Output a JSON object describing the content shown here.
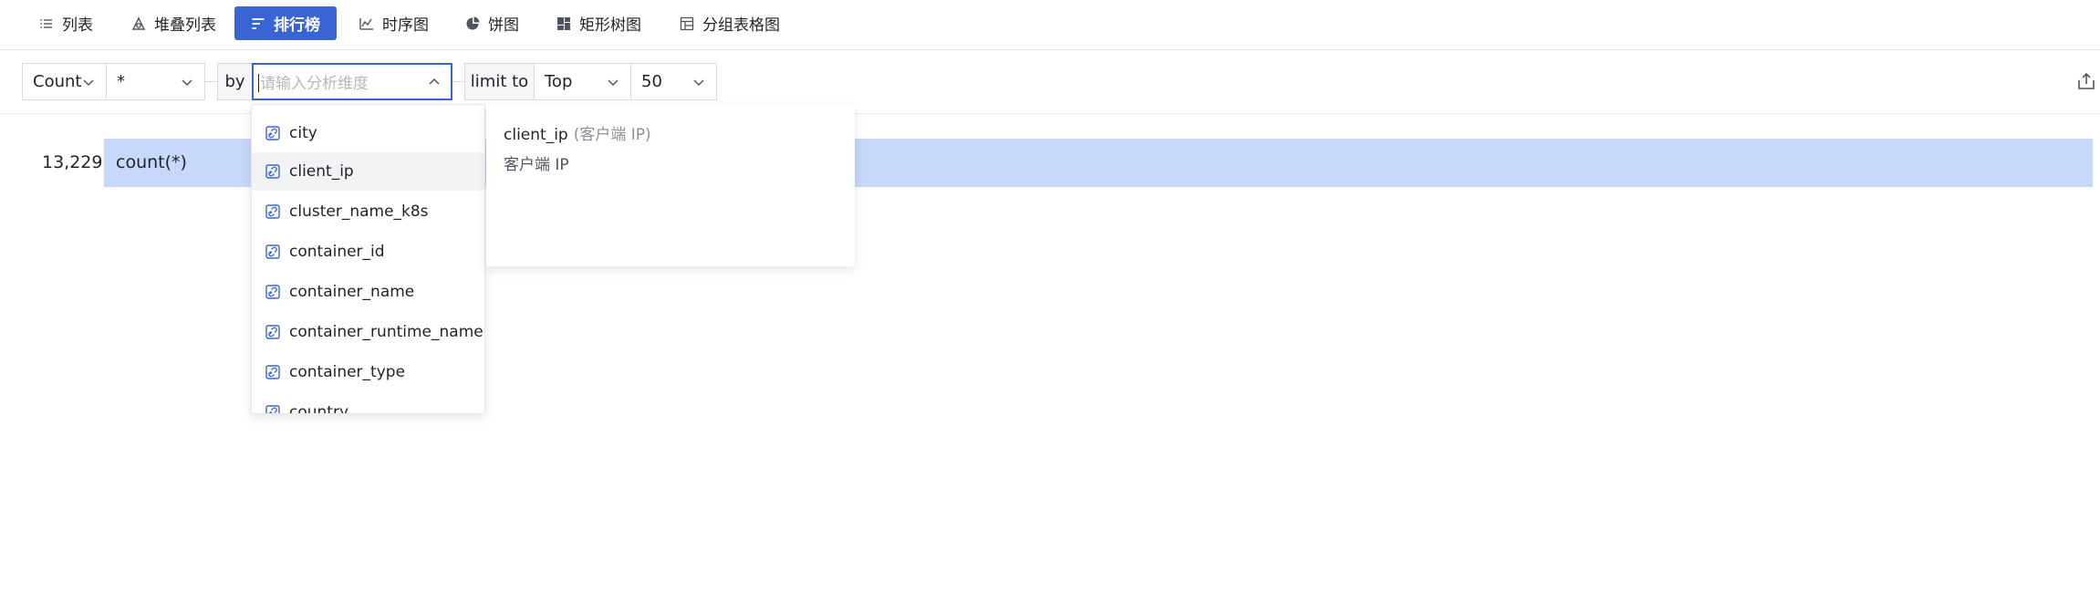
{
  "tabs": [
    {
      "label": "列表",
      "icon": "list-icon",
      "active": false
    },
    {
      "label": "堆叠列表",
      "icon": "stack-icon",
      "active": false
    },
    {
      "label": "排行榜",
      "icon": "ranking-icon",
      "active": true
    },
    {
      "label": "时序图",
      "icon": "timeseries-icon",
      "active": false
    },
    {
      "label": "饼图",
      "icon": "pie-icon",
      "active": false
    },
    {
      "label": "矩形树图",
      "icon": "treemap-icon",
      "active": false
    },
    {
      "label": "分组表格图",
      "icon": "grouped-table-icon",
      "active": false
    }
  ],
  "query": {
    "aggregate": "Count",
    "field": "*",
    "by_label": "by",
    "dimension_placeholder": "请输入分析维度",
    "limit_label": "limit to",
    "order": "Top",
    "limit": "50"
  },
  "result": {
    "value": "13,229",
    "label": "count(*)",
    "bar_fraction": 1.0
  },
  "dropdown": {
    "items": [
      {
        "label": "city"
      },
      {
        "label": "client_ip",
        "hovered": true
      },
      {
        "label": "cluster_name_k8s"
      },
      {
        "label": "container_id"
      },
      {
        "label": "container_name"
      },
      {
        "label": "container_runtime_name"
      },
      {
        "label": "container_type"
      },
      {
        "label": "country"
      }
    ],
    "detail": {
      "name": "client_ip",
      "alias": "(客户端 IP)",
      "description": "客户端 IP"
    }
  },
  "colors": {
    "accent": "#3a63d6",
    "bar": "#c7d8fb",
    "hover": "#f2f3f5"
  }
}
